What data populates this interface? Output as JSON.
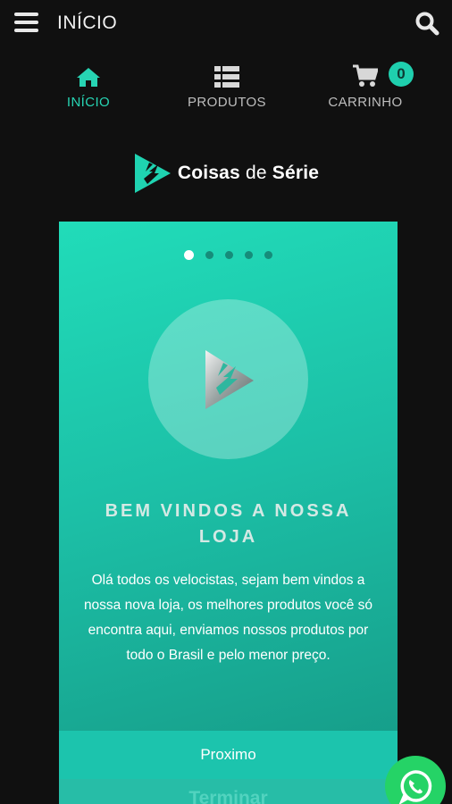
{
  "topbar": {
    "title": "INÍCIO",
    "menu_icon": "hamburger-menu-icon",
    "search_icon": "search-icon"
  },
  "nav": {
    "items": [
      {
        "label": "INÍCIO",
        "icon": "home-icon",
        "active": true
      },
      {
        "label": "PRODUTOS",
        "icon": "list-icon",
        "active": false
      },
      {
        "label": "CARRINHO",
        "icon": "cart-icon",
        "active": false
      }
    ],
    "cart_count": "0"
  },
  "brand": {
    "name_part1": "Coisas ",
    "name_part2": "de",
    "name_part3": " Série"
  },
  "onboarding": {
    "slide_count": 5,
    "active_slide": 1,
    "title": "BEM VINDOS A NOSSA LOJA",
    "description": "Olá todos os velocistas, sejam bem vindos a nossa nova loja, os melhores produtos você só encontra aqui, enviamos nossos produtos por todo o Brasil e pelo menor preço.",
    "next_label": "Proximo",
    "finish_label": "Terminar"
  },
  "colors": {
    "accent": "#27d4b3",
    "card_top": "#21dcb9",
    "card_bottom": "#159784",
    "whatsapp": "#25d366"
  }
}
